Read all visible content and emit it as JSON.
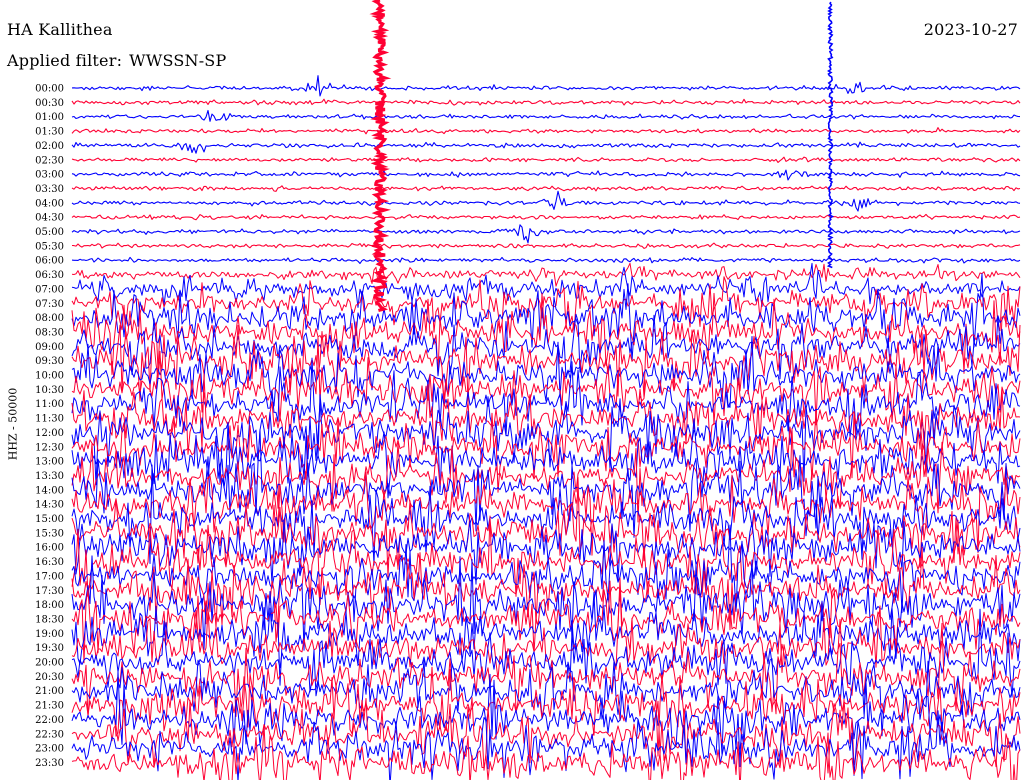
{
  "header": {
    "station": "HA Kallithea",
    "filter_label": "Applied filter:",
    "filter_value": "WWSSN-SP",
    "date": "2023-10-27"
  },
  "chart_data": {
    "type": "line",
    "title": "HA Kallithea",
    "ylabel": "HHZ - 50000",
    "date": "2023-10-27",
    "filter": "WWSSN-SP",
    "y_tick_labels": [
      "00:00",
      "00:30",
      "01:00",
      "01:30",
      "02:00",
      "02:30",
      "03:00",
      "03:30",
      "04:00",
      "04:30",
      "05:00",
      "05:30",
      "06:00",
      "06:30",
      "07:00",
      "07:30",
      "08:00",
      "08:30",
      "09:00",
      "09:30",
      "10:00",
      "10:30",
      "11:00",
      "11:30",
      "12:00",
      "12:30",
      "13:00",
      "13:30",
      "14:00",
      "14:30",
      "15:00",
      "15:30",
      "16:00",
      "16:30",
      "17:00",
      "17:30",
      "18:00",
      "18:30",
      "19:00",
      "19:30",
      "20:00",
      "20:30",
      "21:00",
      "21:30",
      "22:00",
      "22:30",
      "23:00",
      "23:30"
    ],
    "line_minutes": 30,
    "trace_colors": [
      "#0000ff",
      "#ff0033"
    ],
    "noise_onset_label": "06:30",
    "transient_events": [
      {
        "line": "00:00",
        "position": 0.26
      },
      {
        "line": "00:00",
        "position": 0.82
      },
      {
        "line": "01:00",
        "position": 0.15
      },
      {
        "line": "02:00",
        "position": 0.13
      },
      {
        "line": "03:00",
        "position": 0.76
      },
      {
        "line": "04:00",
        "position": 0.51
      },
      {
        "line": "04:00",
        "position": 0.83
      },
      {
        "line": "05:00",
        "position": 0.48
      }
    ],
    "major_spikes": [
      {
        "start_line": "00:00",
        "end_line": "07:30",
        "position": 0.325
      },
      {
        "start_line": "00:00",
        "end_line": "06:00",
        "position": 0.8
      }
    ],
    "grid": false,
    "legend": "none"
  }
}
